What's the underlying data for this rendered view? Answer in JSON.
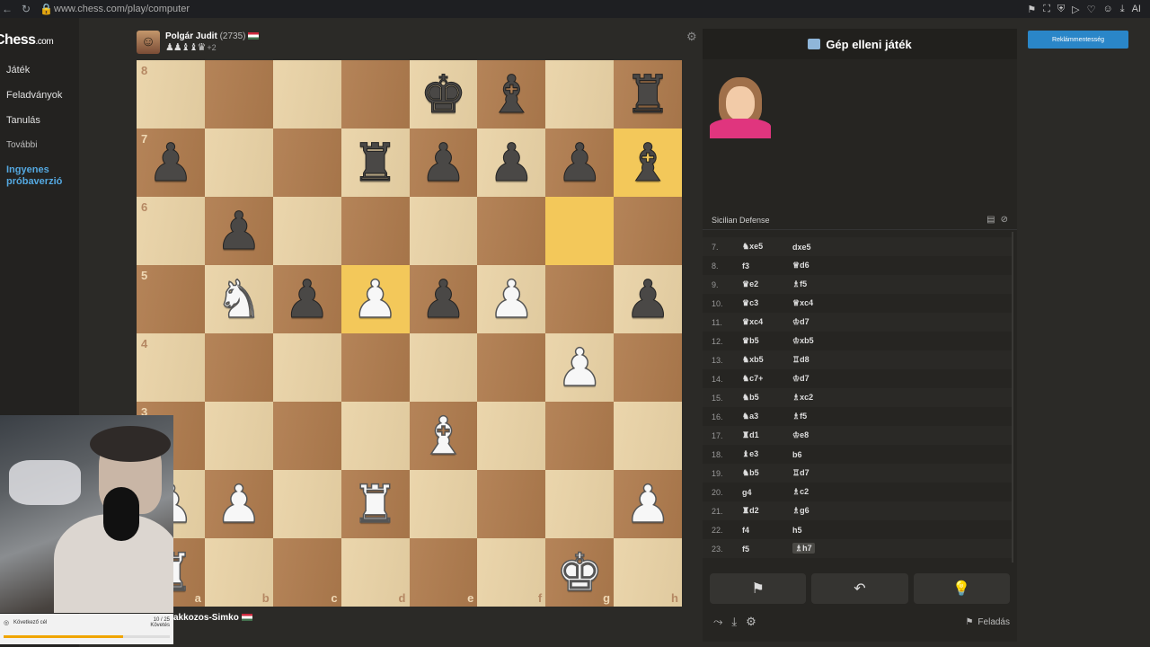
{
  "browser": {
    "url": "www.chess.com/play/computer",
    "nav_icons": [
      "back-icon",
      "reload-icon",
      "lock-icon"
    ],
    "extensions_label": "AI"
  },
  "sidebar": {
    "logo": "Chess",
    "logo_suffix": ".com",
    "items": [
      {
        "label": "Játék"
      },
      {
        "label": "Feladványok"
      },
      {
        "label": "Tanulás"
      },
      {
        "label": "További"
      },
      {
        "label": "Ingyenes próbaverzió"
      }
    ]
  },
  "top_player": {
    "name": "Polgár Judit",
    "rating": "(2735)",
    "captured": "♟♟♝♝♛",
    "captured_plus": "+2"
  },
  "bottom_player": {
    "name": "akkozos-Simko"
  },
  "board": {
    "ranks": [
      "8",
      "7",
      "6",
      "5",
      "4",
      "3",
      "2",
      "1"
    ],
    "files": [
      "a",
      "b",
      "c",
      "d",
      "e",
      "f",
      "g",
      "h"
    ],
    "squares": [
      [
        "",
        "",
        "",
        "",
        "bK",
        "bB",
        "",
        "bR"
      ],
      [
        "bP",
        "",
        "",
        "bR",
        "bP",
        "bP",
        "bP",
        "bB"
      ],
      [
        "",
        "bP",
        "",
        "",
        "",
        "",
        "",
        ""
      ],
      [
        "",
        "wN",
        "bP",
        "wP",
        "bP",
        "wP",
        "",
        "bP"
      ],
      [
        "",
        "",
        "",
        "",
        "",
        "",
        "wP",
        ""
      ],
      [
        "",
        "",
        "",
        "",
        "wB",
        "",
        "",
        ""
      ],
      [
        "wP",
        "wP",
        "",
        "wR",
        "",
        "",
        "",
        "wP"
      ],
      [
        "wR",
        "",
        "",
        "",
        "",
        "",
        "wK",
        ""
      ]
    ],
    "highlights": [
      [
        1,
        7
      ],
      [
        2,
        6
      ],
      [
        3,
        3
      ]
    ]
  },
  "webcam_overlay": {
    "label": "Következő cél",
    "count": "10 / 25",
    "count_sub": "Követés",
    "progress": 0.72
  },
  "panel": {
    "title": "Gép elleni játék",
    "opening": "Sicilian Defense",
    "moves": [
      {
        "no": "7.",
        "w": "♞xe5",
        "b": "dxe5"
      },
      {
        "no": "8.",
        "w": "f3",
        "b": "♕d6"
      },
      {
        "no": "9.",
        "w": "♛e2",
        "b": "♗f5"
      },
      {
        "no": "10.",
        "w": "♛c3",
        "b": "♕xc4"
      },
      {
        "no": "11.",
        "w": "♛xc4",
        "b": "♔d7"
      },
      {
        "no": "12.",
        "w": "♛b5",
        "b": "♔xb5"
      },
      {
        "no": "13.",
        "w": "♞xb5",
        "b": "♖d8"
      },
      {
        "no": "14.",
        "w": "♞c7+",
        "b": "♔d7"
      },
      {
        "no": "15.",
        "w": "♞b5",
        "b": "♗xc2"
      },
      {
        "no": "16.",
        "w": "♞a3",
        "b": "♗f5"
      },
      {
        "no": "17.",
        "w": "♜d1",
        "b": "♔e8"
      },
      {
        "no": "18.",
        "w": "♝e3",
        "b": "b6"
      },
      {
        "no": "19.",
        "w": "♞b5",
        "b": "♖d7"
      },
      {
        "no": "20.",
        "w": "g4",
        "b": "♗c2"
      },
      {
        "no": "21.",
        "w": "♜d2",
        "b": "♗g6"
      },
      {
        "no": "22.",
        "w": "f4",
        "b": "h5"
      },
      {
        "no": "23.",
        "w": "f5",
        "b": "♗h7",
        "current": true
      }
    ],
    "controls": [
      "flag-icon",
      "undo-icon",
      "hint-icon"
    ],
    "resign_label": "Feladás"
  },
  "ad_button": {
    "label": "Reklámmentesség"
  }
}
